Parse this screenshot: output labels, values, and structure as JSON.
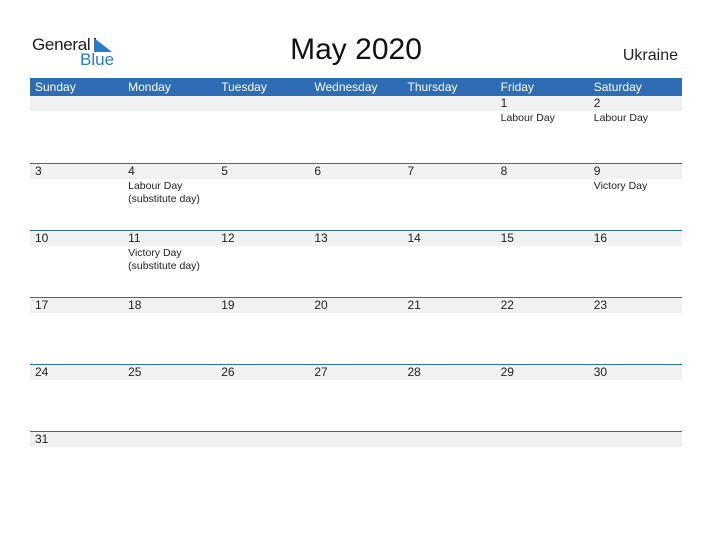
{
  "logo": {
    "word1": "General",
    "word2": "Blue"
  },
  "title": "May 2020",
  "country": "Ukraine",
  "colors": {
    "accent": "#2e6db4",
    "band": "#f1f1f1",
    "logo_blue": "#2a7bc8"
  },
  "weekdays": [
    "Sunday",
    "Monday",
    "Tuesday",
    "Wednesday",
    "Thursday",
    "Friday",
    "Saturday"
  ],
  "weeks": [
    [
      {
        "day": "",
        "holiday": ""
      },
      {
        "day": "",
        "holiday": ""
      },
      {
        "day": "",
        "holiday": ""
      },
      {
        "day": "",
        "holiday": ""
      },
      {
        "day": "",
        "holiday": ""
      },
      {
        "day": "1",
        "holiday": "Labour Day"
      },
      {
        "day": "2",
        "holiday": "Labour Day"
      }
    ],
    [
      {
        "day": "3",
        "holiday": ""
      },
      {
        "day": "4",
        "holiday": "Labour Day (substitute day)"
      },
      {
        "day": "5",
        "holiday": ""
      },
      {
        "day": "6",
        "holiday": ""
      },
      {
        "day": "7",
        "holiday": ""
      },
      {
        "day": "8",
        "holiday": ""
      },
      {
        "day": "9",
        "holiday": "Victory Day"
      }
    ],
    [
      {
        "day": "10",
        "holiday": ""
      },
      {
        "day": "11",
        "holiday": "Victory Day (substitute day)"
      },
      {
        "day": "12",
        "holiday": ""
      },
      {
        "day": "13",
        "holiday": ""
      },
      {
        "day": "14",
        "holiday": ""
      },
      {
        "day": "15",
        "holiday": ""
      },
      {
        "day": "16",
        "holiday": ""
      }
    ],
    [
      {
        "day": "17",
        "holiday": ""
      },
      {
        "day": "18",
        "holiday": ""
      },
      {
        "day": "19",
        "holiday": ""
      },
      {
        "day": "20",
        "holiday": ""
      },
      {
        "day": "21",
        "holiday": ""
      },
      {
        "day": "22",
        "holiday": ""
      },
      {
        "day": "23",
        "holiday": ""
      }
    ],
    [
      {
        "day": "24",
        "holiday": ""
      },
      {
        "day": "25",
        "holiday": ""
      },
      {
        "day": "26",
        "holiday": ""
      },
      {
        "day": "27",
        "holiday": ""
      },
      {
        "day": "28",
        "holiday": ""
      },
      {
        "day": "29",
        "holiday": ""
      },
      {
        "day": "30",
        "holiday": ""
      }
    ],
    [
      {
        "day": "31",
        "holiday": ""
      },
      {
        "day": "",
        "holiday": ""
      },
      {
        "day": "",
        "holiday": ""
      },
      {
        "day": "",
        "holiday": ""
      },
      {
        "day": "",
        "holiday": ""
      },
      {
        "day": "",
        "holiday": ""
      },
      {
        "day": "",
        "holiday": ""
      }
    ]
  ]
}
